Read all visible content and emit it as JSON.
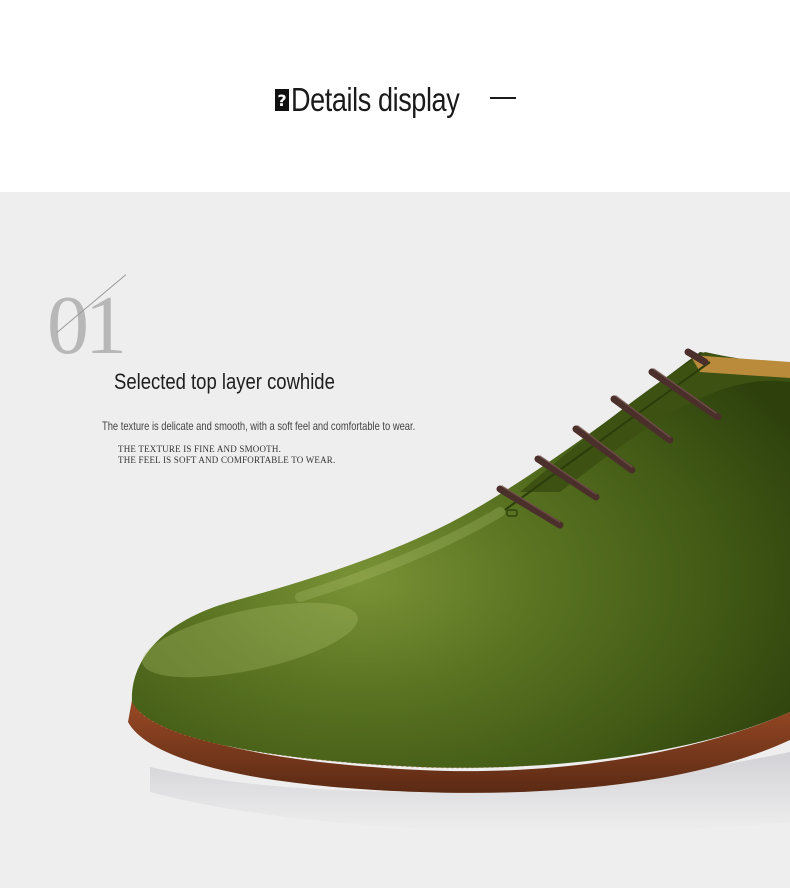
{
  "header": {
    "glyph": "?",
    "title": "Details display"
  },
  "feature": {
    "number": "01",
    "title": "Selected top layer cowhide",
    "description": "The texture is delicate and smooth, with a soft feel and comfortable to wear.",
    "caps_line1": "THE TEXTURE IS FINE AND SMOOTH.",
    "caps_line2": "THE FEEL IS SOFT AND COMFORTABLE TO WEAR."
  },
  "colors": {
    "background_top": "#ffffff",
    "background_panel": "#eeeeee",
    "leather": "#4f6b1e",
    "lace": "#4b2f2a",
    "sole": "#7a3a1f"
  },
  "product_image": {
    "icon": "green-leather-oxford-shoe-icon"
  }
}
